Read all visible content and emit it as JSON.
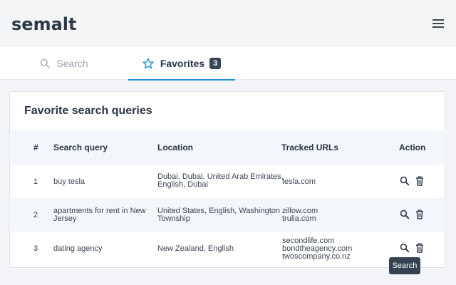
{
  "app": {
    "logo_text": "semalt"
  },
  "header": {
    "menu_icon": "hamburger-icon"
  },
  "tabs": [
    {
      "label": "Search",
      "icon": "search-icon",
      "active": false
    },
    {
      "label": "Favorites",
      "icon": "star-icon",
      "active": true,
      "badge": "3"
    }
  ],
  "card": {
    "title": "Favorite search queries"
  },
  "table": {
    "headers": {
      "num": "#",
      "query": "Search query",
      "location": "Location",
      "urls": "Tracked URLs",
      "action": "Action"
    },
    "rows": [
      {
        "num": "1",
        "query_lines": [
          "buy tesla"
        ],
        "location_lines": [
          "Dubai, Dubai, United Arab Emirates,",
          "English, Dubai"
        ],
        "urls": [
          "tesla.com"
        ]
      },
      {
        "num": "2",
        "query_lines": [
          "apartments for rent in New",
          "Jersey"
        ],
        "location_lines": [
          "United States, English, Washington",
          "Township"
        ],
        "urls": [
          "zillow.com",
          "trulia.com"
        ]
      },
      {
        "num": "3",
        "query_lines": [
          "dating agency"
        ],
        "location_lines": [
          "New Zealand, English"
        ],
        "urls": [
          "secondlife.com",
          "bondtheagency.com",
          "twoscompany.co.nz"
        ]
      }
    ]
  },
  "tooltip": {
    "text": "Search"
  },
  "colors": {
    "accent": "#1f8fd8",
    "badge_bg": "#3a4756",
    "text": "#2a3543"
  }
}
